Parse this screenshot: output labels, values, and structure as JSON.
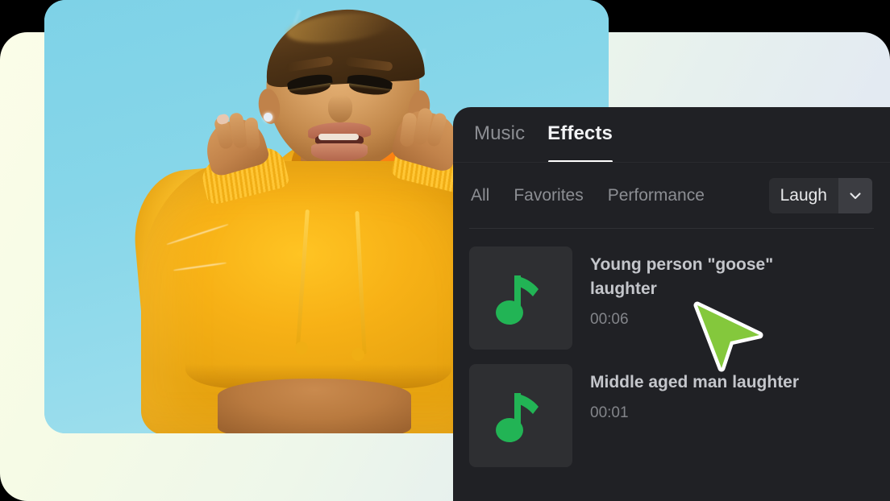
{
  "panel": {
    "tabs": [
      {
        "label": "Music",
        "active": false
      },
      {
        "label": "Effects",
        "active": true
      }
    ],
    "filters": [
      {
        "label": "All"
      },
      {
        "label": "Favorites"
      },
      {
        "label": "Performance"
      }
    ],
    "category_chip": {
      "label": "Laugh",
      "caret_icon": "chevron-down-icon"
    },
    "tracks": [
      {
        "title": "Young person \"goose\" laughter",
        "duration": "00:06",
        "icon": "music-note-icon"
      },
      {
        "title": "Middle aged man laughter",
        "duration": "00:01",
        "icon": "music-note-icon"
      }
    ]
  },
  "preview": {
    "alt": "Woman in yellow cropped hoodie against sky blue background"
  },
  "cursor": {
    "icon": "arrow-pointer-icon"
  },
  "colors": {
    "panel_bg": "#202125",
    "chip_bg": "#2c2d31",
    "chip_caret_bg": "#3c3d42",
    "thumb_bg": "#2e2f32",
    "accent_green": "#22b455",
    "cursor_green": "#84c83c",
    "text_primary": "#f2f3f5",
    "text_secondary": "#8c8e93",
    "track_title": "#c4c6cb",
    "photo_sky": "#86d5e8",
    "photo_hoodie": "#f7b116"
  }
}
